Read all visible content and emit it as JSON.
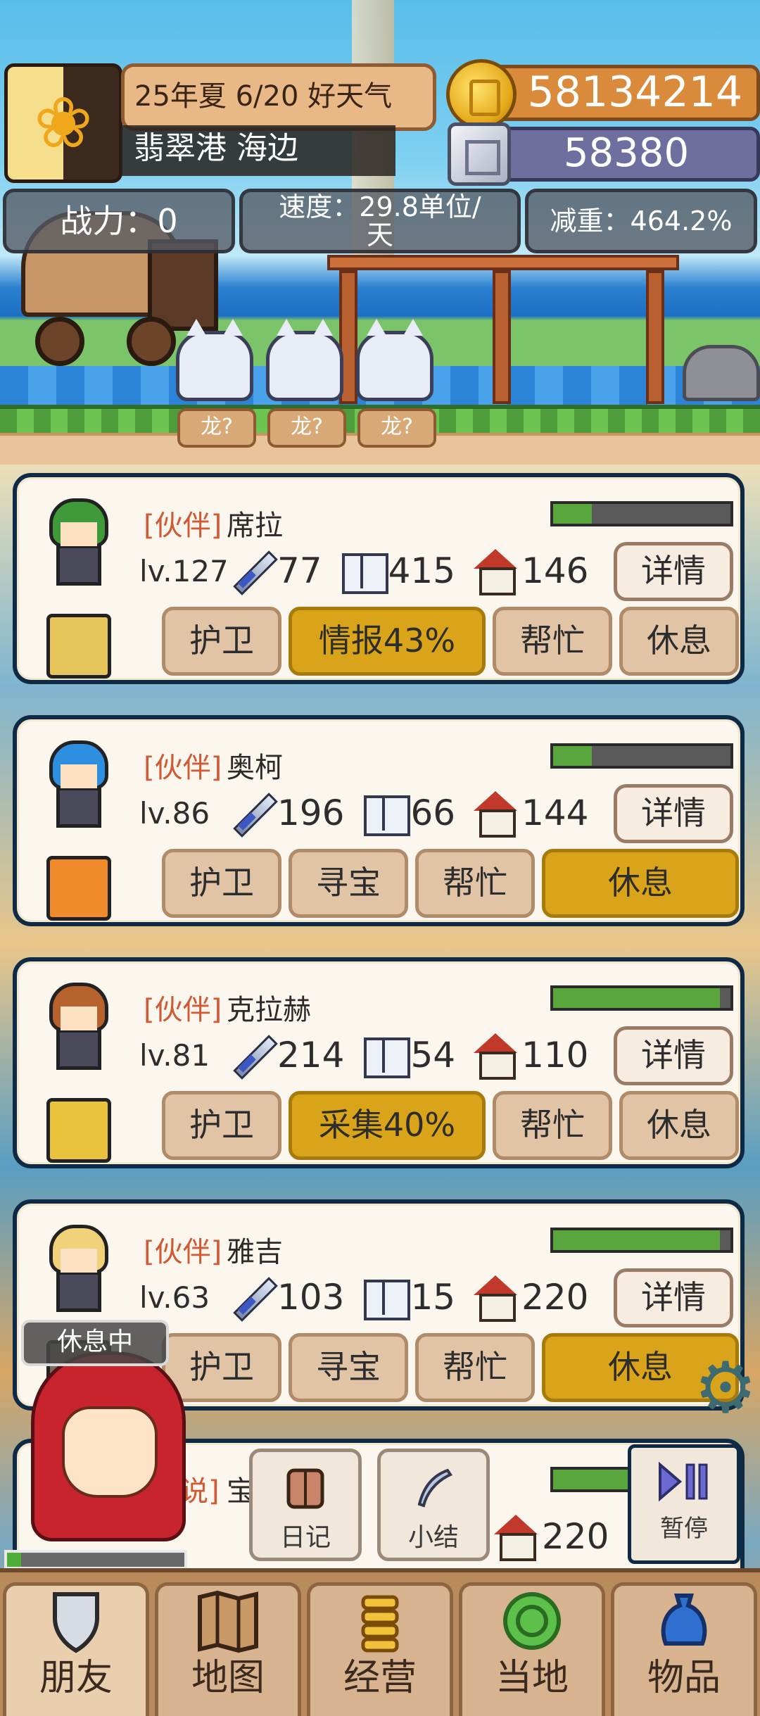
{
  "hud": {
    "date": "25年夏 6/20 好天气",
    "location": "翡翠港 海边",
    "gold": "58134214",
    "silver": "58380",
    "power": "战力：0",
    "speed": "速度：29.8单位/天",
    "weight": "减重：464.2%"
  },
  "scene": {
    "tags": [
      "龙?",
      "龙?",
      "龙?"
    ]
  },
  "companions": [
    {
      "tag": "[伙伴]",
      "name": "席拉",
      "level": "lv.127",
      "attack": "77",
      "intel": "415",
      "house": "146",
      "stamina": 0.22,
      "detail": "详情",
      "actions": [
        "护卫",
        "情报43%",
        "帮忙",
        "休息"
      ],
      "active": 1,
      "hair_color": "#3f9a3a",
      "item_color": "#e5c45a"
    },
    {
      "tag": "[伙伴]",
      "name": "奥柯",
      "level": "lv.86",
      "attack": "196",
      "intel": "66",
      "house": "144",
      "stamina": 0.22,
      "detail": "详情",
      "actions": [
        "护卫",
        "寻宝",
        "帮忙",
        "休息"
      ],
      "active": 3,
      "hair_color": "#2e8fe0",
      "item_color": "#f08a2a"
    },
    {
      "tag": "[伙伴]",
      "name": "克拉赫",
      "level": "lv.81",
      "attack": "214",
      "intel": "54",
      "house": "110",
      "stamina": 0.94,
      "detail": "详情",
      "actions": [
        "护卫",
        "采集40%",
        "帮忙",
        "休息"
      ],
      "active": 1,
      "hair_color": "#b5622c",
      "item_color": "#e8c23a"
    },
    {
      "tag": "[伙伴]",
      "name": "雅吉",
      "level": "lv.63",
      "attack": "103",
      "intel": "15",
      "house": "220",
      "stamina": 0.94,
      "detail": "详情",
      "actions": [
        "护卫",
        "寻宝",
        "帮忙",
        "休息"
      ],
      "active": 3,
      "hair_color": "#f0d27a",
      "item_color": "#7a6a5a"
    }
  ],
  "partial_card": {
    "tag_fragment": "说]",
    "name_fragment": "宝",
    "house": "220"
  },
  "overlay": {
    "rest_badge": "休息中",
    "girl_stamina": 0.08,
    "diary": "日记",
    "summary": "小结",
    "pause": "暂停"
  },
  "navbar": [
    {
      "label": "朋友",
      "icon": "shield-icon"
    },
    {
      "label": "地图",
      "icon": "map-icon"
    },
    {
      "label": "经营",
      "icon": "coin-stack-icon"
    },
    {
      "label": "当地",
      "icon": "local-icon"
    },
    {
      "label": "物品",
      "icon": "bag-icon"
    }
  ],
  "colors": {
    "active_action": "#d9a419",
    "tag_red": "#d15a35",
    "stamina_green": "#59a63c",
    "card_border": "#0f2a44"
  }
}
